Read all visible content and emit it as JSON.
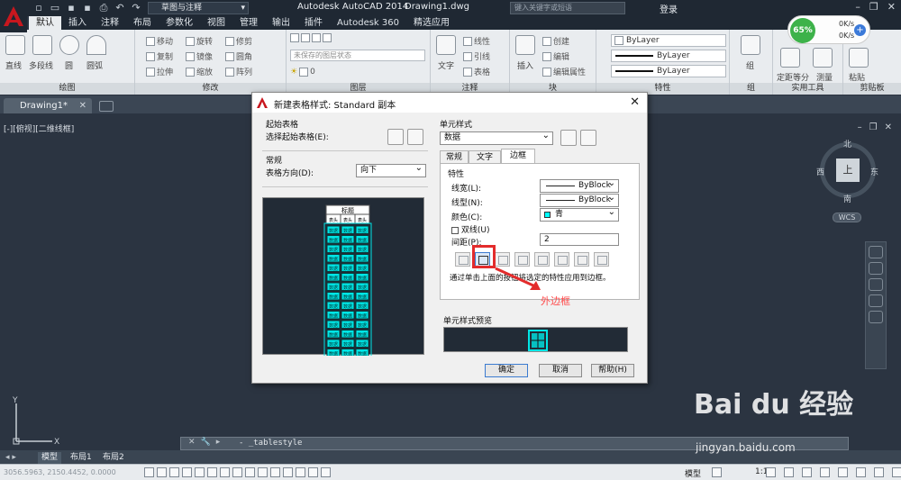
{
  "titlebar": {
    "workspace": "草图与注释",
    "app_title": "Autodesk AutoCAD 2014",
    "doc_title": "Drawing1.dwg",
    "search_placeholder": "键入关键字或短语",
    "login": "登录",
    "brand_color": "#c8171e"
  },
  "ribbon_tabs": [
    "默认",
    "插入",
    "注释",
    "布局",
    "参数化",
    "视图",
    "管理",
    "输出",
    "插件",
    "Autodesk 360",
    "精选应用"
  ],
  "ribbon": {
    "draw": {
      "title": "绘图",
      "line": "直线",
      "polyline": "多段线",
      "circle": "圆",
      "arc": "圆弧"
    },
    "modify": {
      "title": "修改",
      "move": "移动",
      "rotate": "旋转",
      "trim": "修剪",
      "copy": "复制",
      "mirror": "镜像",
      "fillet": "圆角",
      "stretch": "拉伸",
      "scale": "缩放",
      "array": "阵列"
    },
    "layers": {
      "title": "图层",
      "state": "未保存的图层状态",
      "current": "0"
    },
    "annotation": {
      "title": "注释",
      "text": "文字",
      "linear": "线性",
      "leader": "引线",
      "table": "表格"
    },
    "block": {
      "title": "块",
      "insert": "插入",
      "create": "创建",
      "edit": "编辑",
      "edit_attr": "编辑属性"
    },
    "properties": {
      "title": "特性",
      "color": "ByLayer",
      "linetype": "ByLayer",
      "lineweight": "ByLayer"
    },
    "groups": {
      "title": "组",
      "group": "组"
    },
    "utilities": {
      "title": "实用工具",
      "measure": "测量",
      "divide": "定距等分"
    },
    "clipboard": {
      "title": "剪贴板",
      "paste": "粘贴"
    }
  },
  "network_widget": {
    "percent": "65%",
    "up": "0K/s",
    "down": "0K/s"
  },
  "doc_tab": "Drawing1*",
  "viewport_label": "[-][俯视][二维线框]",
  "viewcube": {
    "north": "北",
    "south": "南",
    "east": "东",
    "west": "西",
    "top": "上",
    "wcs": "WCS"
  },
  "dialog": {
    "title": "新建表格样式: Standard 副本",
    "start_table_group": "起始表格",
    "select_start_table": "选择起始表格(E):",
    "general_group": "常规",
    "table_direction_label": "表格方向(D):",
    "table_direction_value": "向下",
    "preview_title_cell": "标题",
    "preview_header_cell": "表头",
    "preview_data_cell": "数据",
    "cell_styles_group": "单元样式",
    "cell_style_value": "数据",
    "tabs": [
      "常规",
      "文字",
      "边框"
    ],
    "active_tab": "边框",
    "properties_group": "特性",
    "lineweight_label": "线宽(L):",
    "lineweight_value": "ByBlock",
    "linetype_label": "线型(N):",
    "linetype_value": "ByBlock",
    "color_label": "颜色(C):",
    "color_value": "青",
    "color_swatch": "#00ffff",
    "double_line_label": "双线(U)",
    "double_line_checked": false,
    "spacing_label": "间距(P):",
    "spacing_value": "2",
    "hint": "通过单击上面的按钮将选定的特性应用到边框。",
    "cell_preview_group": "单元样式预览",
    "ok": "确定",
    "cancel": "取消",
    "help": "帮助(H)"
  },
  "annotation_label": "外边框",
  "cmdline": {
    "text": "- _tablestyle"
  },
  "layout_tabs": [
    "模型",
    "布局1",
    "布局2"
  ],
  "status": {
    "coords": "3056.5963, 2150.4452, 0.0000",
    "model": "模型",
    "scale": "1:1"
  },
  "watermark": {
    "logo": "Bai du 经验",
    "url": "jingyan.baidu.com"
  }
}
